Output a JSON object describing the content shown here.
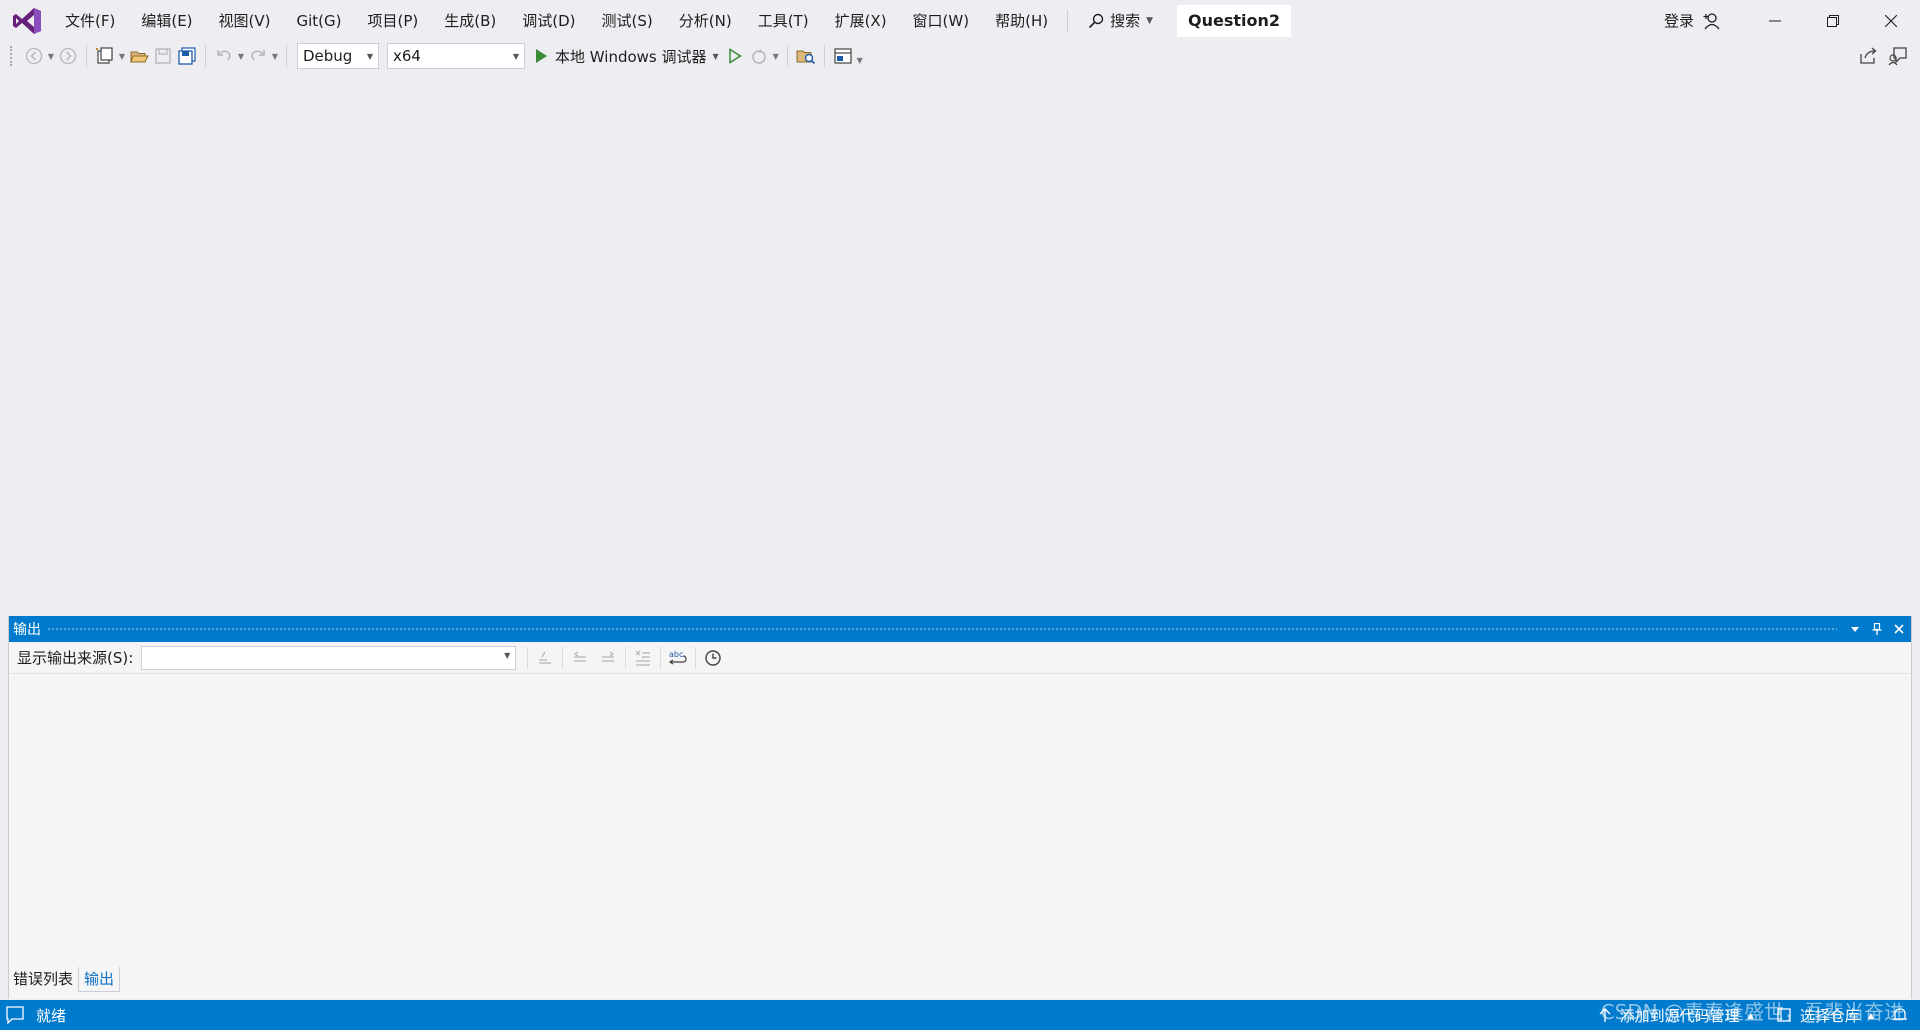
{
  "menubar": {
    "items": [
      "文件(F)",
      "编辑(E)",
      "视图(V)",
      "Git(G)",
      "项目(P)",
      "生成(B)",
      "调试(D)",
      "测试(S)",
      "分析(N)",
      "工具(T)",
      "扩展(X)",
      "窗口(W)",
      "帮助(H)"
    ],
    "search_label": "搜索",
    "solution_name": "Question2",
    "login_label": "登录"
  },
  "toolbar": {
    "config": "Debug",
    "platform": "x64",
    "run_label": "本地 Windows 调试器"
  },
  "output": {
    "title": "输出",
    "source_label": "显示输出来源(S):",
    "source_value": ""
  },
  "bottom_tabs": [
    "错误列表",
    "输出"
  ],
  "statusbar": {
    "ready": "就绪",
    "add_source_control": "添加到源代码管理",
    "select_repo": "选择仓库"
  },
  "watermark": "CSDN @青春逢盛世，吾辈当奋进",
  "colors": {
    "accent": "#007acc",
    "vs_purple": "#68217a",
    "run_green": "#388a34",
    "background": "#eeeef2"
  }
}
